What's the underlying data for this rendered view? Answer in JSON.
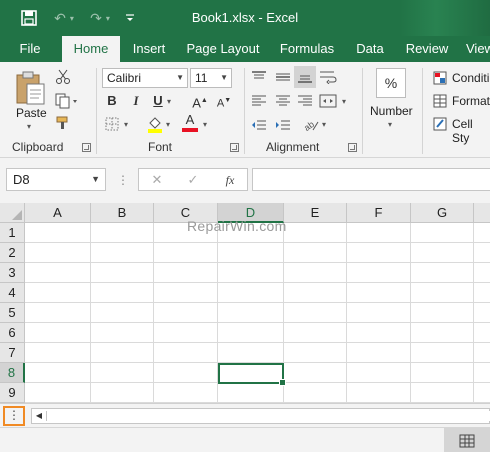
{
  "window": {
    "title": "Book1.xlsx  -  Excel"
  },
  "quick_access": {
    "save_glyph": "💾",
    "undo_glyph": "↶",
    "redo_glyph": "↷",
    "customize_glyph": "≡"
  },
  "tabs": [
    {
      "label": "File"
    },
    {
      "label": "Home"
    },
    {
      "label": "Insert"
    },
    {
      "label": "Page Layout"
    },
    {
      "label": "Formulas"
    },
    {
      "label": "Data"
    },
    {
      "label": "Review"
    },
    {
      "label": "View"
    }
  ],
  "ribbon": {
    "clipboard": {
      "paste_label": "Paste",
      "group_label": "Clipboard"
    },
    "font": {
      "font_name": "Calibri",
      "font_size": "11",
      "bold": "B",
      "italic": "I",
      "underline": "U",
      "grow": "A",
      "shrink": "A",
      "font_color_letter": "A",
      "group_label": "Font"
    },
    "alignment": {
      "group_label": "Alignment"
    },
    "number": {
      "format_symbol": "%",
      "label": "Number"
    },
    "styles": {
      "conditional": "Conditi",
      "format_as": "Format",
      "cell_styles": "Cell Sty"
    }
  },
  "formula_bar": {
    "name_box": "D8",
    "cancel": "✕",
    "enter": "✓",
    "fx": "fx",
    "formula": ""
  },
  "grid": {
    "columns": [
      "A",
      "B",
      "C",
      "D",
      "E",
      "F",
      "G"
    ],
    "rows": [
      "1",
      "2",
      "3",
      "4",
      "5",
      "6",
      "7",
      "8",
      "9"
    ],
    "selected_column": "D",
    "selected_row": "8",
    "active_cell": "D8"
  },
  "watermark": "RepairWin.com",
  "sheet_bar": {
    "more": "⋮",
    "scroll_left": "◀"
  },
  "colors": {
    "accent": "#217346",
    "highlight": "#f08a24",
    "font_color": "#e81123",
    "fill_color": "#ffff00"
  }
}
